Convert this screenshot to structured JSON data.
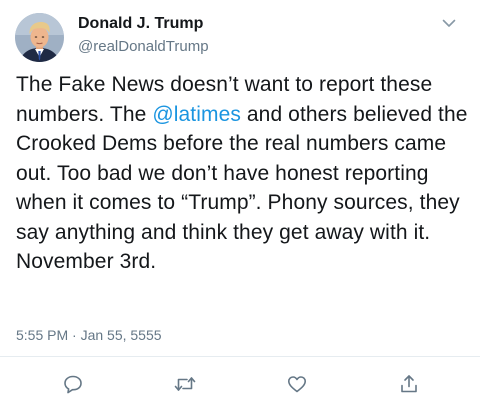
{
  "user": {
    "display_name": "Donald J. Trump",
    "handle": "@realDonaldTrump",
    "avatar_icon": "profile-photo"
  },
  "tweet": {
    "text_before_mention": "The Fake News doesn’t want to report these numbers. The ",
    "mention": "@latimes",
    "text_after_mention": " and others believed the Crooked Dems before the real numbers came out. Too bad we don’t have honest reporting when it comes to “Trump”. Phony sources, they say anything and think they get away with it. November 3rd.",
    "timestamp": "5:55 PM · Jan 55, 5555"
  },
  "actions": [
    {
      "icon": "reply-icon"
    },
    {
      "icon": "retweet-icon"
    },
    {
      "icon": "like-icon"
    },
    {
      "icon": "share-icon"
    }
  ],
  "colors": {
    "link": "#1b95e0",
    "secondary_text": "#657786",
    "primary_text": "#14171a",
    "divider": "#e6ecf0"
  }
}
